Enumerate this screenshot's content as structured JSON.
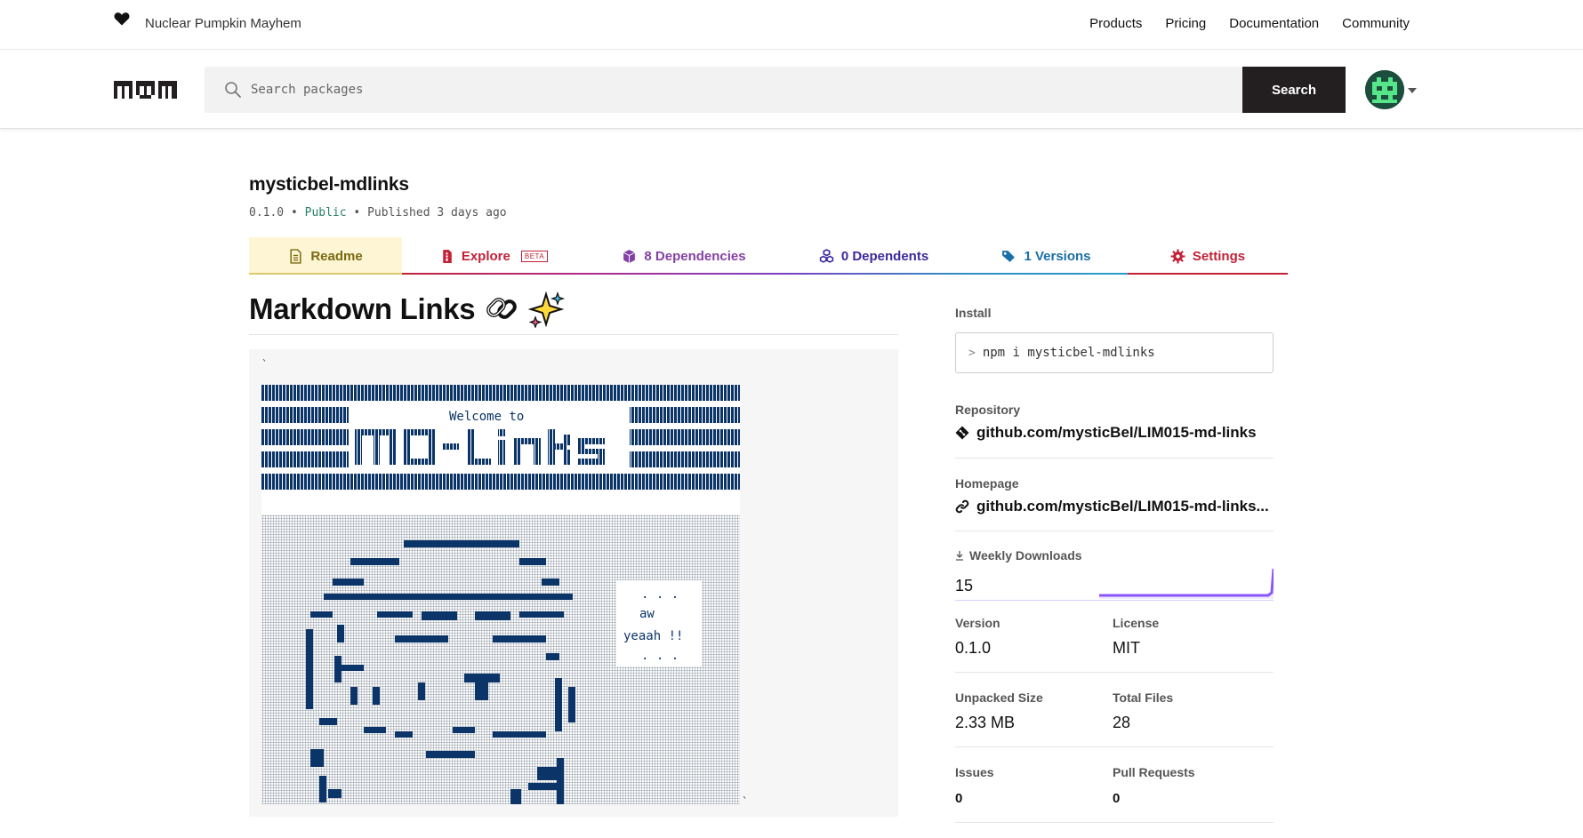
{
  "topbar": {
    "tagline": "Nuclear Pumpkin Mayhem",
    "nav": [
      "Products",
      "Pricing",
      "Documentation",
      "Community"
    ]
  },
  "search": {
    "placeholder": "Search packages",
    "button_label": "Search"
  },
  "package": {
    "name": "mysticbel-mdlinks",
    "version": "0.1.0",
    "visibility": "Public",
    "published": "Published 3 days ago",
    "separator": "•"
  },
  "tabs": {
    "readme": "Readme",
    "explore": "Explore",
    "beta": "BETA",
    "dependencies": "8 Dependencies",
    "dependents": "0 Dependents",
    "versions": "1 Versions",
    "settings": "Settings"
  },
  "readme": {
    "heading": "Markdown Links",
    "backtick_open": "`",
    "backtick_close": "`",
    "art_welcome": "Welcome to",
    "art_speech": [
      ". . .",
      "aw",
      "yeaah !!",
      ". . ."
    ]
  },
  "sidebar": {
    "install_label": "Install",
    "install_prompt": ">",
    "install_command": "npm i mysticbel-mdlinks",
    "repository_label": "Repository",
    "repository_link": "github.com/mysticBel/LIM015-md-links",
    "homepage_label": "Homepage",
    "homepage_link": "github.com/mysticBel/LIM015-md-links...",
    "weekly_downloads_label": "Weekly Downloads",
    "weekly_downloads": "15",
    "version_label": "Version",
    "version_value": "0.1.0",
    "license_label": "License",
    "license_value": "MIT",
    "unpacked_label": "Unpacked Size",
    "unpacked_value": "2.33 MB",
    "files_label": "Total Files",
    "files_value": "28",
    "issues_label": "Issues",
    "issues_value": "0",
    "prs_label": "Pull Requests",
    "prs_value": "0"
  },
  "colors": {
    "art_navy": "#0b3468",
    "sparkline": "#8956ff",
    "public_green": "#28816a"
  }
}
